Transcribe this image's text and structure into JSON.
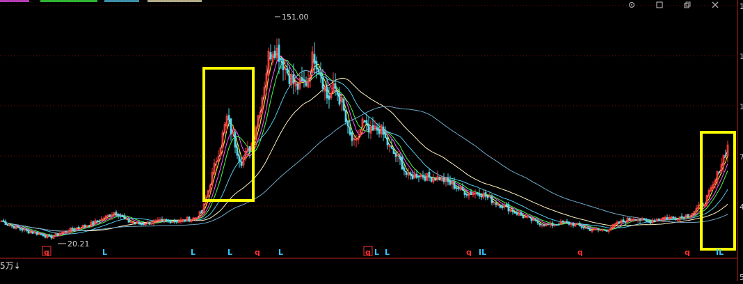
{
  "chart_data": {
    "type": "candlestick",
    "title": "",
    "ylim": [
      15,
      170
    ],
    "grid": true,
    "colors": {
      "up": "#ff3b3b",
      "down": "#56d8e8",
      "ma5": "#ffffff",
      "ma10": "#ffff33",
      "ma20": "#ff55ff",
      "ma30": "#44ff44",
      "ma60": "#55ccee",
      "ma120": "#fff3c0",
      "ma250": "#6fa8c8",
      "highlight": "#ffff00",
      "signal_q": "#ff3030",
      "signal_l": "#33c8ff"
    },
    "annotations": [
      {
        "label": "151.00",
        "type": "high"
      },
      {
        "label": "20.21",
        "type": "low"
      }
    ],
    "right_axis_ticks": [
      "1",
      "1",
      "1",
      "7",
      "4"
    ],
    "lower_axis_tick": "5",
    "volume_label": "5万↓",
    "signals": [
      "q",
      "L",
      "L",
      "L",
      "q",
      "L",
      "q",
      "L",
      "L",
      "q",
      "IL",
      "q",
      "q",
      "IL"
    ],
    "top_icons": [
      "settings-icon",
      "maximize-icon",
      "restore-icon",
      "close-icon"
    ],
    "trend_points": [
      [
        0,
        32
      ],
      [
        20,
        28
      ],
      [
        40,
        25
      ],
      [
        60,
        23
      ],
      [
        70,
        21
      ],
      [
        85,
        24
      ],
      [
        105,
        27
      ],
      [
        130,
        30
      ],
      [
        150,
        34
      ],
      [
        165,
        38
      ],
      [
        180,
        32
      ],
      [
        200,
        30
      ],
      [
        220,
        31
      ],
      [
        240,
        32
      ],
      [
        260,
        32
      ],
      [
        280,
        34
      ],
      [
        290,
        38
      ],
      [
        300,
        55
      ],
      [
        315,
        80
      ],
      [
        325,
        98
      ],
      [
        335,
        85
      ],
      [
        345,
        70
      ],
      [
        360,
        80
      ],
      [
        375,
        110
      ],
      [
        385,
        138
      ],
      [
        392,
        145
      ],
      [
        400,
        140
      ],
      [
        410,
        130
      ],
      [
        425,
        118
      ],
      [
        440,
        122
      ],
      [
        450,
        140
      ],
      [
        460,
        128
      ],
      [
        470,
        110
      ],
      [
        480,
        118
      ],
      [
        490,
        108
      ],
      [
        500,
        88
      ],
      [
        510,
        80
      ],
      [
        520,
        96
      ],
      [
        530,
        88
      ],
      [
        545,
        92
      ],
      [
        560,
        78
      ],
      [
        575,
        70
      ],
      [
        585,
        60
      ],
      [
        600,
        62
      ],
      [
        615,
        60
      ],
      [
        630,
        60
      ],
      [
        650,
        55
      ],
      [
        670,
        50
      ],
      [
        690,
        50
      ],
      [
        710,
        44
      ],
      [
        730,
        40
      ],
      [
        750,
        35
      ],
      [
        770,
        31
      ],
      [
        790,
        29
      ],
      [
        810,
        31
      ],
      [
        830,
        29
      ],
      [
        850,
        26
      ],
      [
        870,
        26
      ],
      [
        890,
        31
      ],
      [
        910,
        34
      ],
      [
        930,
        31
      ],
      [
        950,
        34
      ],
      [
        970,
        34
      ],
      [
        990,
        36
      ],
      [
        1010,
        43
      ],
      [
        1025,
        55
      ],
      [
        1040,
        75
      ],
      [
        1045,
        80
      ]
    ]
  }
}
